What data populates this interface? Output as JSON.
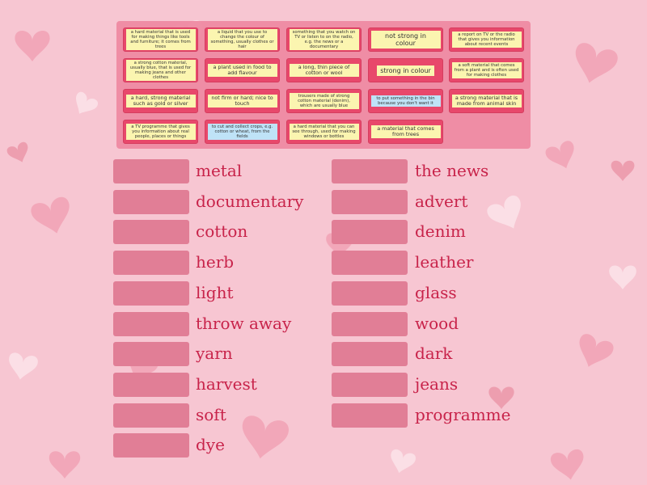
{
  "colors": {
    "background": "#f7c6d2",
    "tray": "#ee8aa2",
    "card": "#e8486b",
    "slot": "#e17e96",
    "word_text": "#c8234a",
    "label_yellow": "#fbf5b0",
    "label_blue": "#bfe3f7"
  },
  "cards": [
    {
      "text": "a hard material that is used for making things like tools and furniture; it comes from trees",
      "style": "yellow"
    },
    {
      "text": "a liquid that you use to change the colour of something, usually clothes or hair",
      "style": "yellow"
    },
    {
      "text": "something that you watch on TV or listen to on the radio, e.g. the news or a documentary",
      "style": "yellow"
    },
    {
      "text": "not strong in colour",
      "style": "yellow"
    },
    {
      "text": "a report on TV or the radio that gives you information about recent events",
      "style": "yellow"
    },
    {
      "text": "a strong cotton material, usually blue, that is used for making jeans and other clothes",
      "style": "yellow"
    },
    {
      "text": "a plant used in food to add flavour",
      "style": "yellow"
    },
    {
      "text": "a long, thin piece of cotton or wool",
      "style": "yellow"
    },
    {
      "text": "strong in colour",
      "style": "yellow"
    },
    {
      "text": "a soft material that comes from a plant and is often used for making clothes",
      "style": "yellow"
    },
    {
      "text": "a hard, strong material such as gold or silver",
      "style": "yellow"
    },
    {
      "text": "not firm or hard; nice to touch",
      "style": "yellow"
    },
    {
      "text": "trousers made of strong cotton material (denim), which are usually blue",
      "style": "yellow"
    },
    {
      "text": "to put something in the bin because you don't want it",
      "style": "blue"
    },
    {
      "text": "a strong material that is made from animal skin",
      "style": "yellow"
    },
    {
      "text": "a TV programme that gives you information about real people, places or things",
      "style": "yellow"
    },
    {
      "text": "to cut and collect crops, e.g. cotton or wheat, from the fields",
      "style": "blue"
    },
    {
      "text": "a hard material that you can see through, used for making windows or bottles",
      "style": "yellow"
    },
    {
      "text": "a material that comes from trees",
      "style": "yellow"
    }
  ],
  "words_left": [
    "metal",
    "documentary",
    "cotton",
    "herb",
    "light",
    "throw away",
    "yarn",
    "harvest",
    "soft",
    "dye"
  ],
  "words_right": [
    "the news",
    "advert",
    "denim",
    "leather",
    "glass",
    "wood",
    "dark",
    "jeans",
    "programme"
  ]
}
